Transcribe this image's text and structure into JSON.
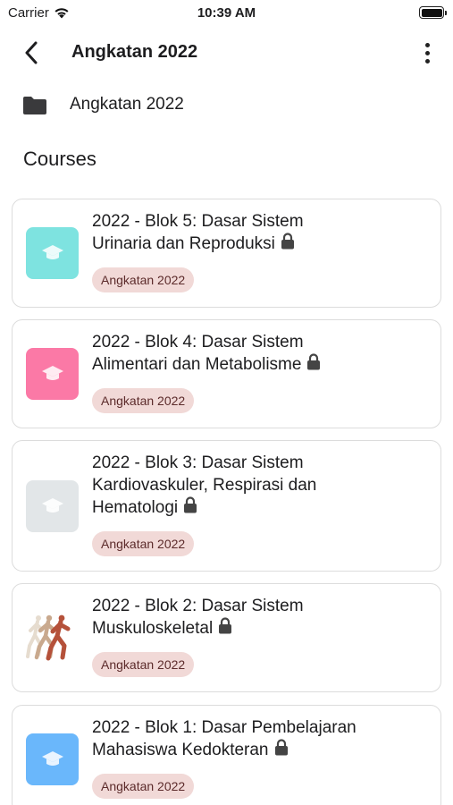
{
  "status_bar": {
    "carrier": "Carrier",
    "time": "10:39 AM"
  },
  "nav": {
    "title": "Angkatan 2022",
    "back_icon": "chevron-left-icon",
    "menu_icon": "more-vertical-icon"
  },
  "breadcrumb": {
    "icon": "folder-icon",
    "label": "Angkatan 2022"
  },
  "section": {
    "heading": "Courses"
  },
  "colors": {
    "badge_bg": "#f1d9d7",
    "badge_text": "#5c2b2b",
    "card_border": "#dcdcdc"
  },
  "courses": [
    {
      "title_line1": "2022 - Blok 5: Dasar Sistem",
      "title_line2": "Urinaria dan Reproduksi",
      "title_line3": "",
      "badge": "Angkatan 2022",
      "thumb_type": "icon",
      "thumb_color": "#7ee3e0",
      "locked": true
    },
    {
      "title_line1": "2022 - Blok 4: Dasar Sistem",
      "title_line2": "Alimentari dan Metabolisme",
      "title_line3": "",
      "badge": "Angkatan 2022",
      "thumb_type": "icon",
      "thumb_color": "#fb79a6",
      "locked": true
    },
    {
      "title_line1": "2022 - Blok 3: Dasar Sistem",
      "title_line2": "Kardiovaskuler, Respirasi dan",
      "title_line3": "Hematologi",
      "badge": "Angkatan 2022",
      "thumb_type": "icon",
      "thumb_color": "#e2e6e8",
      "locked": true
    },
    {
      "title_line1": "2022 - Blok 2: Dasar Sistem",
      "title_line2": "Muskuloskeletal",
      "title_line3": "",
      "badge": "Angkatan 2022",
      "thumb_type": "image",
      "thumb_color": "#ffffff",
      "locked": true
    },
    {
      "title_line1": "2022 - Blok 1: Dasar Pembelajaran",
      "title_line2": "Mahasiswa Kedokteran",
      "title_line3": "",
      "badge": "Angkatan 2022",
      "thumb_type": "icon",
      "thumb_color": "#6ab7fb",
      "locked": true
    }
  ]
}
